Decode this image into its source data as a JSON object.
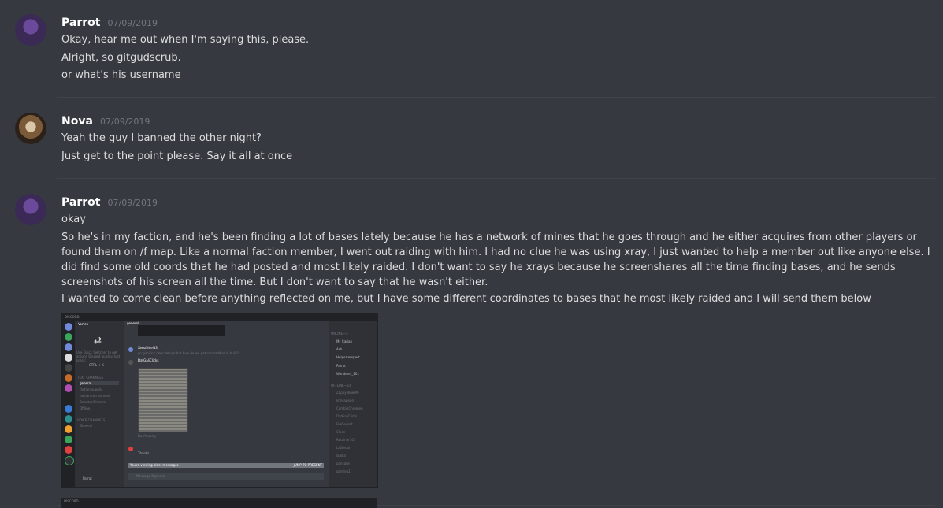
{
  "messages": [
    {
      "username": "Parrot",
      "timestamp": "07/09/2019",
      "lines": [
        "Okay, hear me out when I'm saying this, please.",
        "Alright, so gitgudscrub.",
        "or what's his username"
      ]
    },
    {
      "username": "Nova",
      "timestamp": "07/09/2019",
      "lines": [
        "Yeah the guy I banned the other night?",
        "Just get to the point please. Say it all at once"
      ]
    },
    {
      "username": "Parrot",
      "timestamp": "07/09/2019",
      "lines": [
        "okay",
        "So he's in my faction, and he's been finding a lot of bases lately because he has a network of mines that he goes through and he either acquires from other players or found them on /f map. Like a normal faction member, I went out raiding with him. I had no clue he was using xray, I just wanted to help a member out like anyone else. I did find some old coords that he had posted and most likely raided. I don't want to say he xrays because he screenshares all the time finding bases, and he sends screenshots of his screen all the time. But I don't want to say that he wasn't either.",
        "I wanted to come clean before anything reflected on me, but I have some different coordinates to bases that he most likely raided and I will send them below"
      ]
    }
  ],
  "attachment": {
    "app_label": "DISCORD",
    "server_name": "Vortex",
    "channel": "general",
    "switch_hint": "Use Quick Switcher to get around Discord quickly. Just press:",
    "switch_key": "CTRL + K",
    "text_channels_header": "TEXT CHANNELS",
    "text_channels": [
      "general",
      "faction-supply",
      "faction-recruitment",
      "Donater/Chrome",
      "Offline"
    ],
    "voice_header": "VOICE CHANNELS",
    "voice_channels": [
      "General"
    ],
    "chat_users": [
      "XenoShield3",
      "DatGaliClicks"
    ],
    "chat_line_1": "yo gimi ink clear design but how do we get contraddire in built?",
    "chat_line_2": "Don't worry",
    "chat_line_3": "Thanks",
    "notice": "You're viewing older messages",
    "jump": "JUMP TO PRESENT",
    "input_placeholder": "Message #general",
    "self_name": "Parrot",
    "members_header_online": "ONLINE—4",
    "members_online": [
      "Mr_Itarian_",
      "Ash",
      "Helpertempest",
      "Parrot",
      "Wonderer_101"
    ],
    "members_header_offline": "OFFLINE—14",
    "members_offline": [
      "ZappyMinerPE",
      "JimHawson",
      "CombinChromen",
      "DatGaliClicks",
      "FireSocket",
      "Clyde",
      "Retainer101",
      "LaGlecal",
      "laallia",
      "pancake",
      "gaming1"
    ],
    "bottom_app_label": "DISCORD"
  }
}
